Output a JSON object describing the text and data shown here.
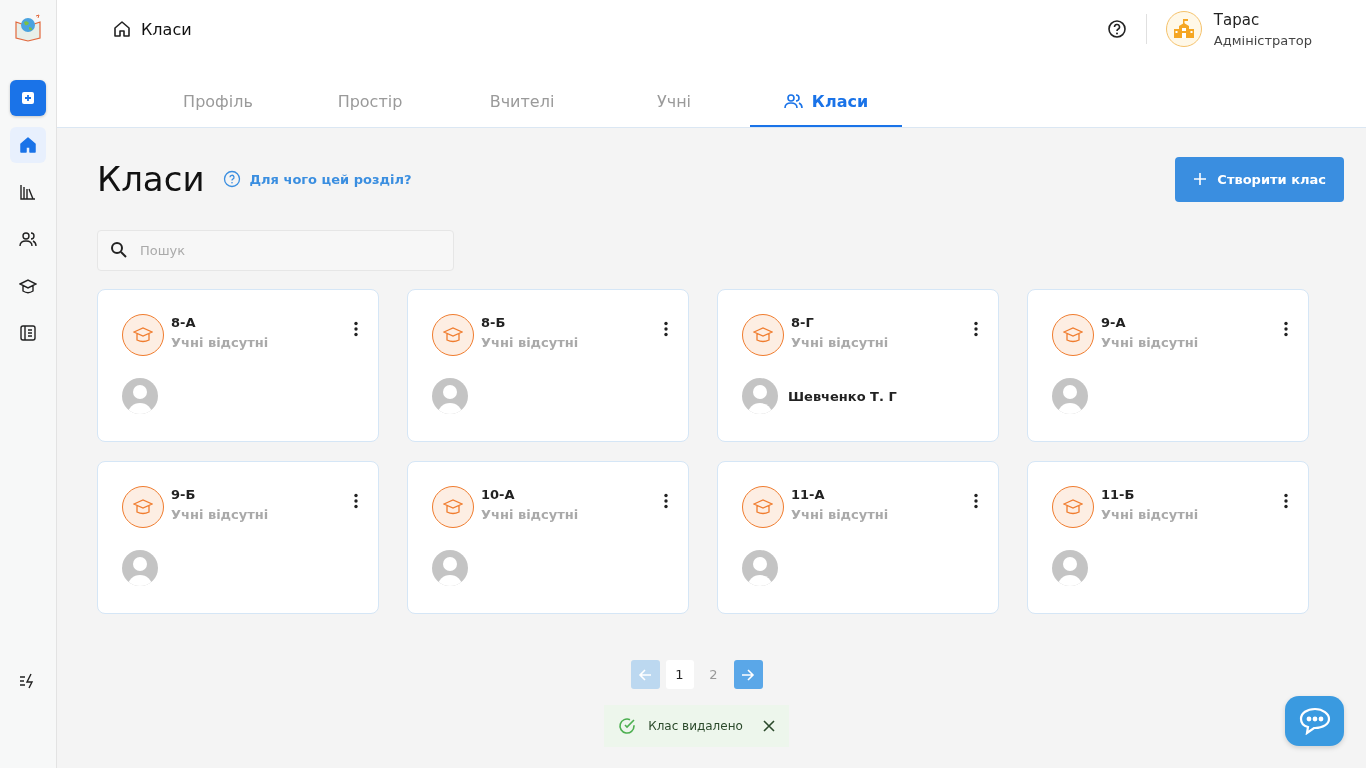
{
  "sidebar": {
    "items": [
      {
        "kind": "add"
      },
      {
        "kind": "home",
        "selected": true
      },
      {
        "kind": "library",
        "selected": false
      },
      {
        "kind": "people",
        "selected": false
      },
      {
        "kind": "cap",
        "selected": false
      },
      {
        "kind": "journal",
        "selected": false
      }
    ]
  },
  "header": {
    "breadcrumb": "Класи",
    "user": {
      "name": "Тарас",
      "role": "Адміністратор"
    }
  },
  "tabs": [
    {
      "label": "Профіль",
      "selected": false
    },
    {
      "label": "Простір",
      "selected": false
    },
    {
      "label": "Вчителі",
      "selected": false
    },
    {
      "label": "Учні",
      "selected": false
    },
    {
      "label": "Класи",
      "selected": true
    }
  ],
  "page": {
    "title": "Класи",
    "help_link": "Для чого цей розділ?",
    "create_button": "Створити клас"
  },
  "search": {
    "placeholder": "Пошук"
  },
  "classes": [
    {
      "name": "8-А",
      "status": "Учні відсутні"
    },
    {
      "name": "8-Б",
      "status": "Учні відсутні"
    },
    {
      "name": "8-Г",
      "status": "Учні відсутні",
      "teacher": "Шевченко Т. Г"
    },
    {
      "name": "9-А",
      "status": "Учні відсутні"
    },
    {
      "name": "9-Б",
      "status": "Учні відсутні"
    },
    {
      "name": "10-А",
      "status": "Учні відсутні"
    },
    {
      "name": "11-А",
      "status": "Учні відсутні"
    },
    {
      "name": "11-Б",
      "status": "Учні відсутні"
    }
  ],
  "pagination": {
    "prev_disabled": true,
    "next_disabled": false,
    "pages": [
      {
        "label": "1",
        "selected": true
      },
      {
        "label": "2",
        "selected": false
      }
    ]
  },
  "toast": {
    "message": "Клас видалено"
  }
}
